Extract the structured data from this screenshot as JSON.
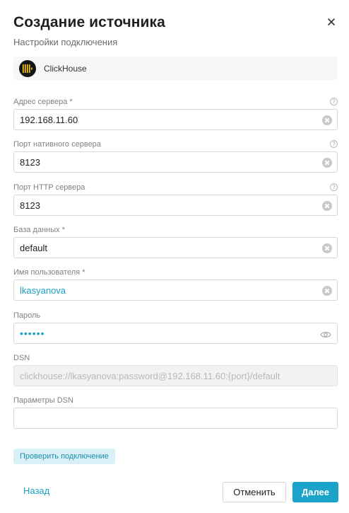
{
  "dialog": {
    "title": "Создание источника",
    "subtitle": "Настройки подключения",
    "close_icon": "close-icon"
  },
  "source": {
    "name": "ClickHouse",
    "logo_icon": "clickhouse-logo"
  },
  "fields": {
    "server_address": {
      "label": "Адрес сервера",
      "required": "*",
      "value": "192.168.11.60",
      "help": "?"
    },
    "native_port": {
      "label": "Порт нативного сервера",
      "value": "8123",
      "help": "?"
    },
    "http_port": {
      "label": "Порт HTTP сервера",
      "value": "8123",
      "help": "?"
    },
    "database": {
      "label": "База данных",
      "required": "*",
      "value": "default"
    },
    "username": {
      "label": "Имя пользователя",
      "required": "*",
      "value": "lkasyanova"
    },
    "password": {
      "label": "Пароль",
      "value": "••••••"
    },
    "dsn": {
      "label": "DSN",
      "value": "clickhouse://lkasyanova:password@192.168.11.60:{port}/default"
    },
    "dsn_params": {
      "label": "Параметры DSN",
      "value": ""
    }
  },
  "actions": {
    "check_connection": "Проверить подключение",
    "back": "Назад",
    "cancel": "Отменить",
    "next": "Далее"
  },
  "colors": {
    "accent": "#1ca3c9",
    "accent_light": "#d9f0f6"
  }
}
